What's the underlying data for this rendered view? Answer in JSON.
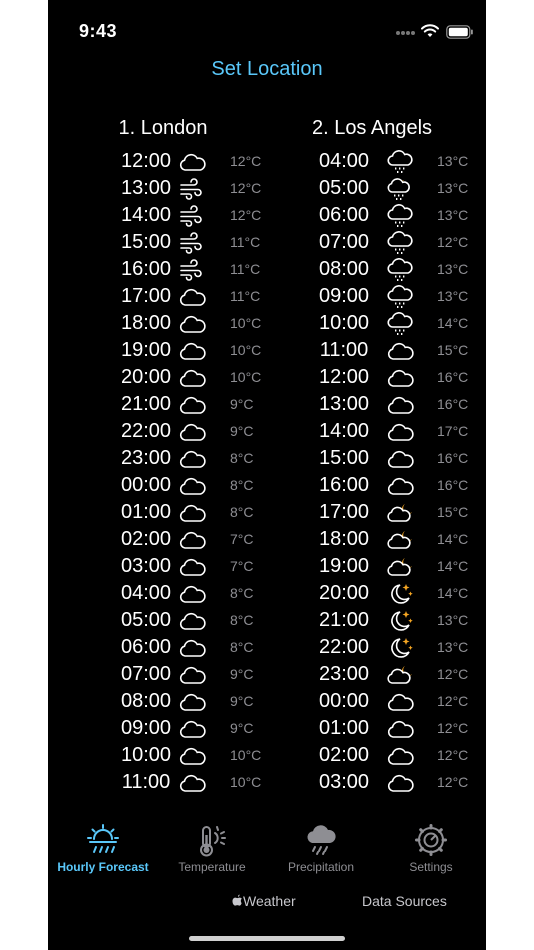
{
  "status": {
    "time": "9:43"
  },
  "header": {
    "set_location": "Set Location"
  },
  "locations": [
    {
      "title": "1. London",
      "rows": [
        {
          "time": "12:00",
          "icon": "cloud-icon",
          "temp": "12°C"
        },
        {
          "time": "13:00",
          "icon": "wind-icon",
          "temp": "12°C"
        },
        {
          "time": "14:00",
          "icon": "wind-icon",
          "temp": "12°C"
        },
        {
          "time": "15:00",
          "icon": "wind-icon",
          "temp": "11°C"
        },
        {
          "time": "16:00",
          "icon": "wind-icon",
          "temp": "11°C"
        },
        {
          "time": "17:00",
          "icon": "cloud-icon",
          "temp": "11°C"
        },
        {
          "time": "18:00",
          "icon": "cloud-icon",
          "temp": "10°C"
        },
        {
          "time": "19:00",
          "icon": "cloud-icon",
          "temp": "10°C"
        },
        {
          "time": "20:00",
          "icon": "cloud-icon",
          "temp": "10°C"
        },
        {
          "time": "21:00",
          "icon": "cloud-icon",
          "temp": "9°C"
        },
        {
          "time": "22:00",
          "icon": "cloud-icon",
          "temp": "9°C"
        },
        {
          "time": "23:00",
          "icon": "cloud-icon",
          "temp": "8°C"
        },
        {
          "time": "00:00",
          "icon": "cloud-icon",
          "temp": "8°C"
        },
        {
          "time": "01:00",
          "icon": "cloud-icon",
          "temp": "8°C"
        },
        {
          "time": "02:00",
          "icon": "cloud-icon",
          "temp": "7°C"
        },
        {
          "time": "03:00",
          "icon": "cloud-icon",
          "temp": "7°C"
        },
        {
          "time": "04:00",
          "icon": "cloud-icon",
          "temp": "8°C"
        },
        {
          "time": "05:00",
          "icon": "cloud-icon",
          "temp": "8°C"
        },
        {
          "time": "06:00",
          "icon": "cloud-icon",
          "temp": "8°C"
        },
        {
          "time": "07:00",
          "icon": "cloud-icon",
          "temp": "9°C"
        },
        {
          "time": "08:00",
          "icon": "cloud-icon",
          "temp": "9°C"
        },
        {
          "time": "09:00",
          "icon": "cloud-icon",
          "temp": "9°C"
        },
        {
          "time": "10:00",
          "icon": "cloud-icon",
          "temp": "10°C"
        },
        {
          "time": "11:00",
          "icon": "cloud-icon",
          "temp": "10°C"
        }
      ]
    },
    {
      "title": "2. Los Angels",
      "rows": [
        {
          "time": "04:00",
          "icon": "cloud-drizzle-icon",
          "temp": "13°C"
        },
        {
          "time": "05:00",
          "icon": "cloud-moon-rain-icon",
          "temp": "13°C"
        },
        {
          "time": "06:00",
          "icon": "cloud-drizzle-icon",
          "temp": "13°C"
        },
        {
          "time": "07:00",
          "icon": "cloud-drizzle-icon",
          "temp": "12°C"
        },
        {
          "time": "08:00",
          "icon": "cloud-drizzle-icon",
          "temp": "13°C"
        },
        {
          "time": "09:00",
          "icon": "cloud-drizzle-icon",
          "temp": "13°C"
        },
        {
          "time": "10:00",
          "icon": "cloud-drizzle-icon",
          "temp": "14°C"
        },
        {
          "time": "11:00",
          "icon": "cloud-icon",
          "temp": "15°C"
        },
        {
          "time": "12:00",
          "icon": "cloud-icon",
          "temp": "16°C"
        },
        {
          "time": "13:00",
          "icon": "cloud-icon",
          "temp": "16°C"
        },
        {
          "time": "14:00",
          "icon": "cloud-icon",
          "temp": "17°C"
        },
        {
          "time": "15:00",
          "icon": "cloud-icon",
          "temp": "16°C"
        },
        {
          "time": "16:00",
          "icon": "cloud-icon",
          "temp": "16°C"
        },
        {
          "time": "17:00",
          "icon": "cloud-moon-icon",
          "temp": "15°C"
        },
        {
          "time": "18:00",
          "icon": "cloud-moon-icon",
          "temp": "14°C"
        },
        {
          "time": "19:00",
          "icon": "cloud-moon-icon",
          "temp": "14°C"
        },
        {
          "time": "20:00",
          "icon": "moon-stars-icon",
          "temp": "14°C"
        },
        {
          "time": "21:00",
          "icon": "moon-stars-icon",
          "temp": "13°C"
        },
        {
          "time": "22:00",
          "icon": "moon-stars-icon",
          "temp": "13°C"
        },
        {
          "time": "23:00",
          "icon": "cloud-moon-icon",
          "temp": "12°C"
        },
        {
          "time": "00:00",
          "icon": "cloud-icon",
          "temp": "12°C"
        },
        {
          "time": "01:00",
          "icon": "cloud-icon",
          "temp": "12°C"
        },
        {
          "time": "02:00",
          "icon": "cloud-icon",
          "temp": "12°C"
        },
        {
          "time": "03:00",
          "icon": "cloud-icon",
          "temp": "12°C"
        }
      ]
    }
  ],
  "tabs": [
    {
      "label": "Hourly Forecast",
      "icon": "sun-rain-icon",
      "active": true
    },
    {
      "label": "Temperature",
      "icon": "thermometer-sun-icon",
      "active": false
    },
    {
      "label": "Precipitation",
      "icon": "cloud-rain-icon",
      "active": false
    },
    {
      "label": "Settings",
      "icon": "gear-icon",
      "active": false
    }
  ],
  "footer": {
    "weather": "Weather",
    "data_sources": "Data Sources"
  },
  "colors": {
    "accent": "#5ac8fa",
    "moon": "#f5a623",
    "muted": "#8e8e93"
  }
}
